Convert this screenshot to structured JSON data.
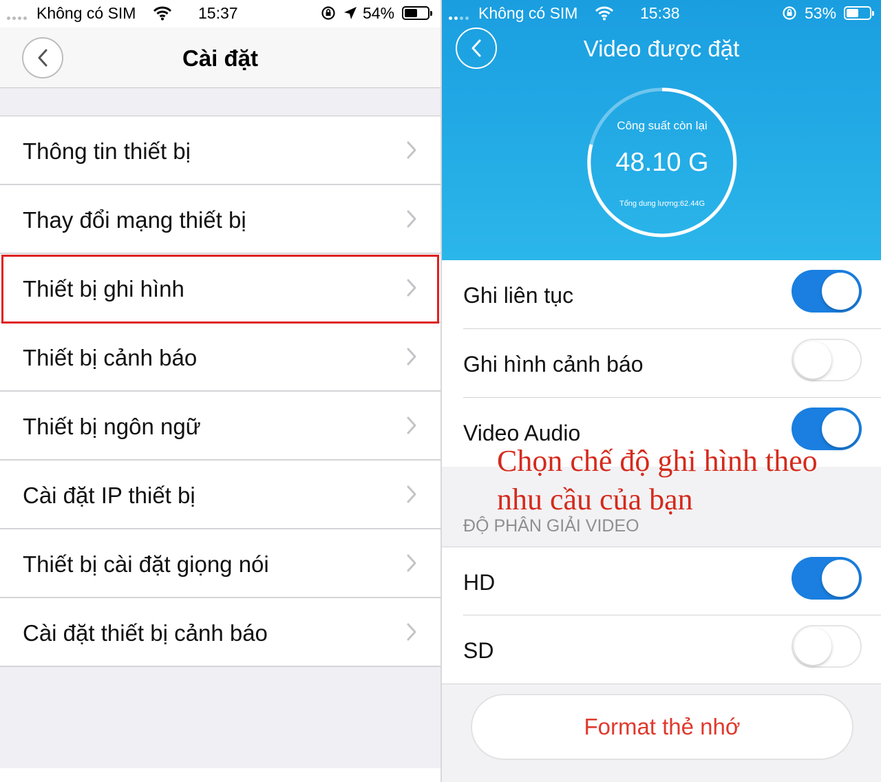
{
  "left": {
    "status": {
      "carrier": "Không có SIM",
      "time": "15:37",
      "battery": "54%",
      "battery_level": 0.54
    },
    "header": {
      "title": "Cài đặt"
    },
    "items": [
      {
        "label": "Thông tin thiết bị"
      },
      {
        "label": "Thay đổi mạng thiết bị"
      },
      {
        "label": "Thiết bị ghi hình"
      },
      {
        "label": "Thiết bị cảnh báo"
      },
      {
        "label": "Thiết bị ngôn ngữ"
      },
      {
        "label": "Cài đặt IP thiết bị"
      },
      {
        "label": "Thiết bị cài đặt giọng nói"
      },
      {
        "label": "Cài đặt thiết bị cảnh báo"
      }
    ],
    "highlighted_item": "Thiết bị ghi hình"
  },
  "right": {
    "status": {
      "carrier": "Không có SIM",
      "time": "15:38",
      "battery": "53%",
      "battery_level": 0.53
    },
    "header": {
      "title": "Video được đặt"
    },
    "storage": {
      "label": "Công suất còn lại",
      "value": "48.10 G",
      "total": "Tổng dung lượng:62.44G"
    },
    "toggles": [
      {
        "label": "Ghi liên tục",
        "on": true
      },
      {
        "label": "Ghi hình cảnh báo",
        "on": false
      },
      {
        "label": "Video Audio",
        "on": true
      }
    ],
    "resolution_section": "ĐỘ PHÂN GIẢI VIDEO",
    "resolutions": [
      {
        "label": "HD",
        "on": true
      },
      {
        "label": "SD",
        "on": false
      }
    ],
    "format_button": "Format thẻ nhớ",
    "annotation": "Chọn chế độ ghi hình theo nhu cầu của bạn"
  },
  "colors": {
    "accent_blue": "#1a7fe0",
    "header_blue": "#1fa6e4",
    "highlight_red": "#e02020",
    "format_red": "#e0392d",
    "annotation_red": "#d52a1c"
  },
  "icons": [
    "back-chevron-icon",
    "chevron-right-icon",
    "wifi-icon",
    "rotation-lock-icon",
    "location-arrow-icon",
    "battery-icon",
    "signal-dots-icon"
  ]
}
